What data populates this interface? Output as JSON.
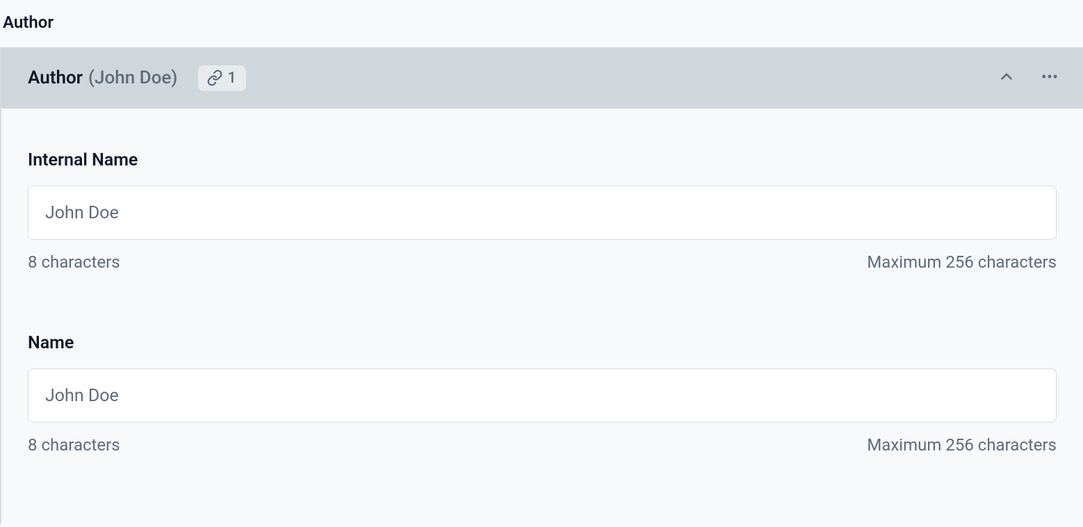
{
  "section": {
    "title": "Author"
  },
  "entry": {
    "type_label": "Author",
    "display_name": "(John Doe)",
    "link_count": "1"
  },
  "fields": [
    {
      "label": "Internal Name",
      "value": "John Doe",
      "count_hint": "8 characters",
      "max_hint": "Maximum 256 characters"
    },
    {
      "label": "Name",
      "value": "John Doe",
      "count_hint": "8 characters",
      "max_hint": "Maximum 256 characters"
    }
  ]
}
